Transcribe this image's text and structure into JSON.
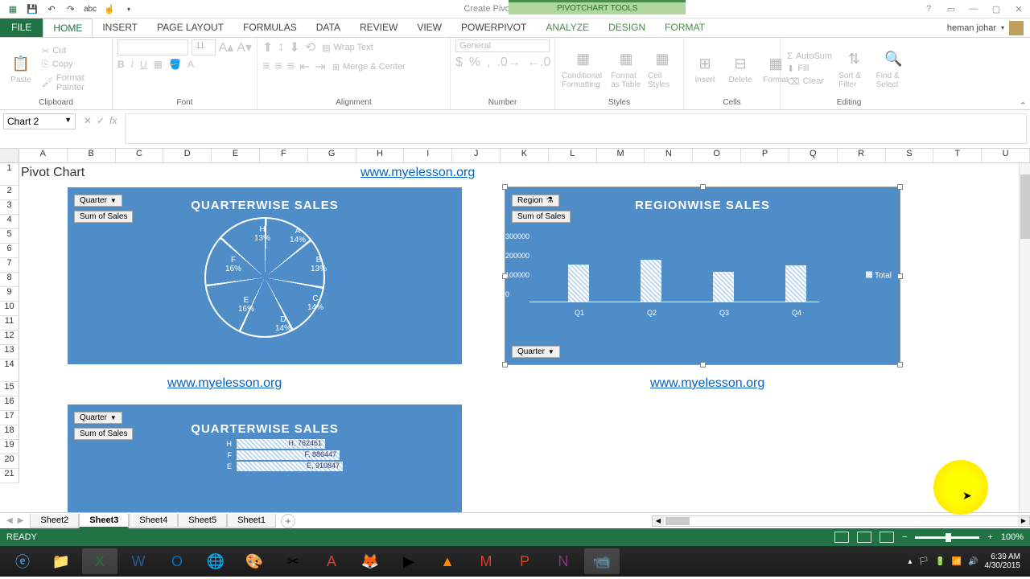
{
  "app": {
    "title": "Create Pivot Chart - Excel",
    "contextual_tab_group": "PIVOTCHART TOOLS",
    "user": "heman johar"
  },
  "qat": [
    "save",
    "undo",
    "redo",
    "spell",
    "touch"
  ],
  "tabs": {
    "file": "FILE",
    "list": [
      "HOME",
      "INSERT",
      "PAGE LAYOUT",
      "FORMULAS",
      "DATA",
      "REVIEW",
      "VIEW",
      "POWERPIVOT"
    ],
    "contextual": [
      "ANALYZE",
      "DESIGN",
      "FORMAT"
    ],
    "active": "HOME"
  },
  "ribbon": {
    "clipboard": {
      "label": "Clipboard",
      "paste": "Paste",
      "cut": "Cut",
      "copy": "Copy",
      "fp": "Format Painter"
    },
    "font": {
      "label": "Font",
      "size": "11"
    },
    "alignment": {
      "label": "Alignment",
      "wrap": "Wrap Text",
      "merge": "Merge & Center"
    },
    "number": {
      "label": "Number",
      "format": "General"
    },
    "styles": {
      "label": "Styles",
      "cf": "Conditional Formatting",
      "fat": "Format as Table",
      "cs": "Cell Styles"
    },
    "cells": {
      "label": "Cells",
      "insert": "Insert",
      "delete": "Delete",
      "format": "Format"
    },
    "editing": {
      "label": "Editing",
      "autosum": "AutoSum",
      "fill": "Fill",
      "clear": "Clear",
      "sort": "Sort & Filter",
      "find": "Find & Select"
    }
  },
  "namebox": "Chart 2",
  "columns": [
    "A",
    "B",
    "C",
    "D",
    "E",
    "F",
    "G",
    "H",
    "I",
    "J",
    "K",
    "L",
    "M",
    "N",
    "O",
    "P",
    "Q",
    "R",
    "S",
    "T",
    "U"
  ],
  "rows": [
    1,
    2,
    3,
    4,
    5,
    6,
    7,
    8,
    9,
    10,
    11,
    12,
    13,
    14,
    15,
    16,
    17,
    18,
    19,
    20,
    21
  ],
  "cells": {
    "a1": "Pivot Chart",
    "link1": "www.myelesson.org",
    "link2": "www.myelesson.org",
    "link3": "www.myelesson.org"
  },
  "chart1": {
    "title": "QUARTERWISE SALES",
    "filter": "Quarter",
    "value_field": "Sum of Sales"
  },
  "chart2": {
    "title": "REGIONWISE SALES",
    "filter_top": "Region",
    "filter_bottom": "Quarter",
    "value_field": "Sum of Sales",
    "legend": "Total"
  },
  "chart3": {
    "title": "QUARTERWISE SALES",
    "filter": "Quarter",
    "value_field": "Sum of Sales"
  },
  "chart_data": [
    {
      "type": "pie",
      "title": "QUARTERWISE SALES",
      "categories": [
        "A",
        "B",
        "C",
        "D",
        "E",
        "F",
        "H"
      ],
      "values": [
        14,
        13,
        14,
        14,
        16,
        16,
        13
      ],
      "value_format": "percent"
    },
    {
      "type": "bar",
      "title": "REGIONWISE SALES",
      "categories": [
        "Q1",
        "Q2",
        "Q3",
        "Q4"
      ],
      "series": [
        {
          "name": "Total",
          "values": [
            195000,
            220000,
            160000,
            190000
          ]
        }
      ],
      "ylabel": "",
      "ylim": [
        0,
        300000
      ],
      "yticks": [
        0,
        100000,
        200000,
        300000
      ]
    },
    {
      "type": "bar_horizontal",
      "title": "QUARTERWISE SALES",
      "categories": [
        "H",
        "F",
        "E"
      ],
      "values": [
        762461,
        886447,
        910847
      ],
      "partial": true
    }
  ],
  "sheets": {
    "list": [
      "Sheet2",
      "Sheet3",
      "Sheet4",
      "Sheet5",
      "Sheet1"
    ],
    "active": "Sheet3"
  },
  "status": {
    "ready": "READY",
    "zoom": "100%"
  },
  "tray": {
    "time": "6:39 AM",
    "date": "4/30/2015"
  }
}
